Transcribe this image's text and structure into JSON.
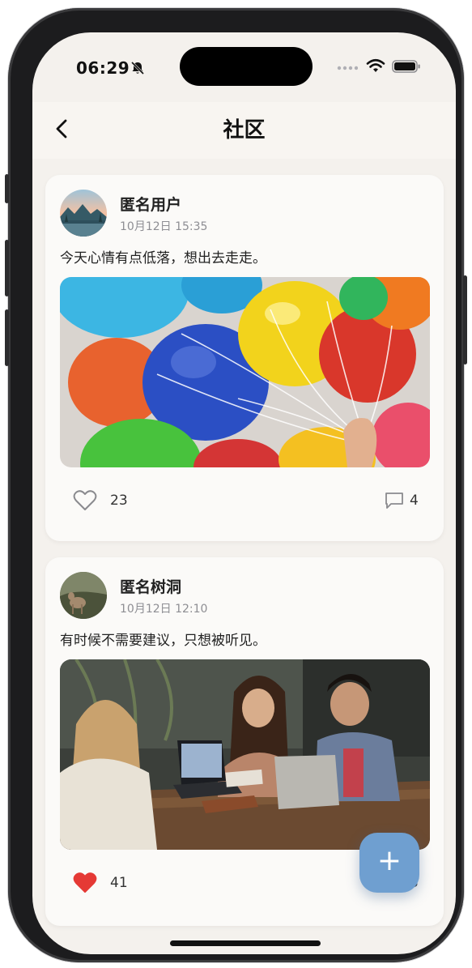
{
  "status_bar": {
    "time": "06:29"
  },
  "nav": {
    "title": "社区",
    "back_icon": "chevron-left-icon"
  },
  "posts": [
    {
      "author": "匿名用户",
      "time": "10月12日 15:35",
      "text": "今天心情有点低落，想出去走走。",
      "image": "colorful-balloons",
      "likes": "23",
      "liked": false,
      "comments": "4"
    },
    {
      "author": "匿名树洞",
      "time": "10月12日 12:10",
      "text": "有时候不需要建议，只想被听见。",
      "image": "friends-laughing-at-table",
      "likes": "41",
      "liked": true,
      "comments": "3"
    }
  ],
  "fab": {
    "label": "+"
  },
  "colors": {
    "background": "#f4f1ed",
    "accent": "#6f9fd0",
    "liked": "#e53935"
  }
}
